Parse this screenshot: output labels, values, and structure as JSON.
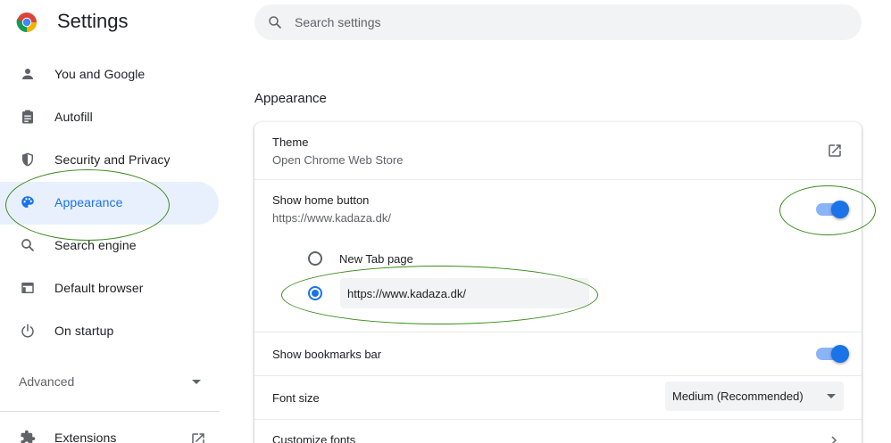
{
  "app": {
    "title": "Settings",
    "logo_icon": "chrome-logo-icon"
  },
  "search": {
    "placeholder": "Search settings",
    "icon": "search-icon"
  },
  "sidebar": {
    "items": [
      {
        "label": "You and Google",
        "icon": "person-icon",
        "active": false
      },
      {
        "label": "Autofill",
        "icon": "clipboard-icon",
        "active": false
      },
      {
        "label": "Security and Privacy",
        "icon": "shield-icon",
        "active": false
      },
      {
        "label": "Appearance",
        "icon": "palette-icon",
        "active": true
      },
      {
        "label": "Search engine",
        "icon": "magnifier-icon",
        "active": false
      },
      {
        "label": "Default browser",
        "icon": "browser-window-icon",
        "active": false
      },
      {
        "label": "On startup",
        "icon": "power-icon",
        "active": false
      }
    ],
    "advanced_label": "Advanced",
    "extensions_label": "Extensions"
  },
  "main": {
    "section_title": "Appearance",
    "theme": {
      "label": "Theme",
      "sublabel": "Open Chrome Web Store",
      "icon": "open-in-new-icon"
    },
    "home_button": {
      "label": "Show home button",
      "sublabel": "https://www.kadaza.dk/",
      "enabled": true,
      "options": [
        {
          "label": "New Tab page",
          "selected": false
        },
        {
          "label": "",
          "selected": true
        }
      ],
      "custom_url_value": "https://www.kadaza.dk/"
    },
    "bookmarks_bar": {
      "label": "Show bookmarks bar",
      "enabled": true
    },
    "font_size": {
      "label": "Font size",
      "value": "Medium (Recommended)"
    },
    "customize_fonts": {
      "label": "Customize fonts"
    }
  },
  "colors": {
    "accent": "#1a73e8",
    "accent_light": "#8ab4f8",
    "active_bg": "#e8f0fe",
    "annotation": "#3a8a1c"
  }
}
